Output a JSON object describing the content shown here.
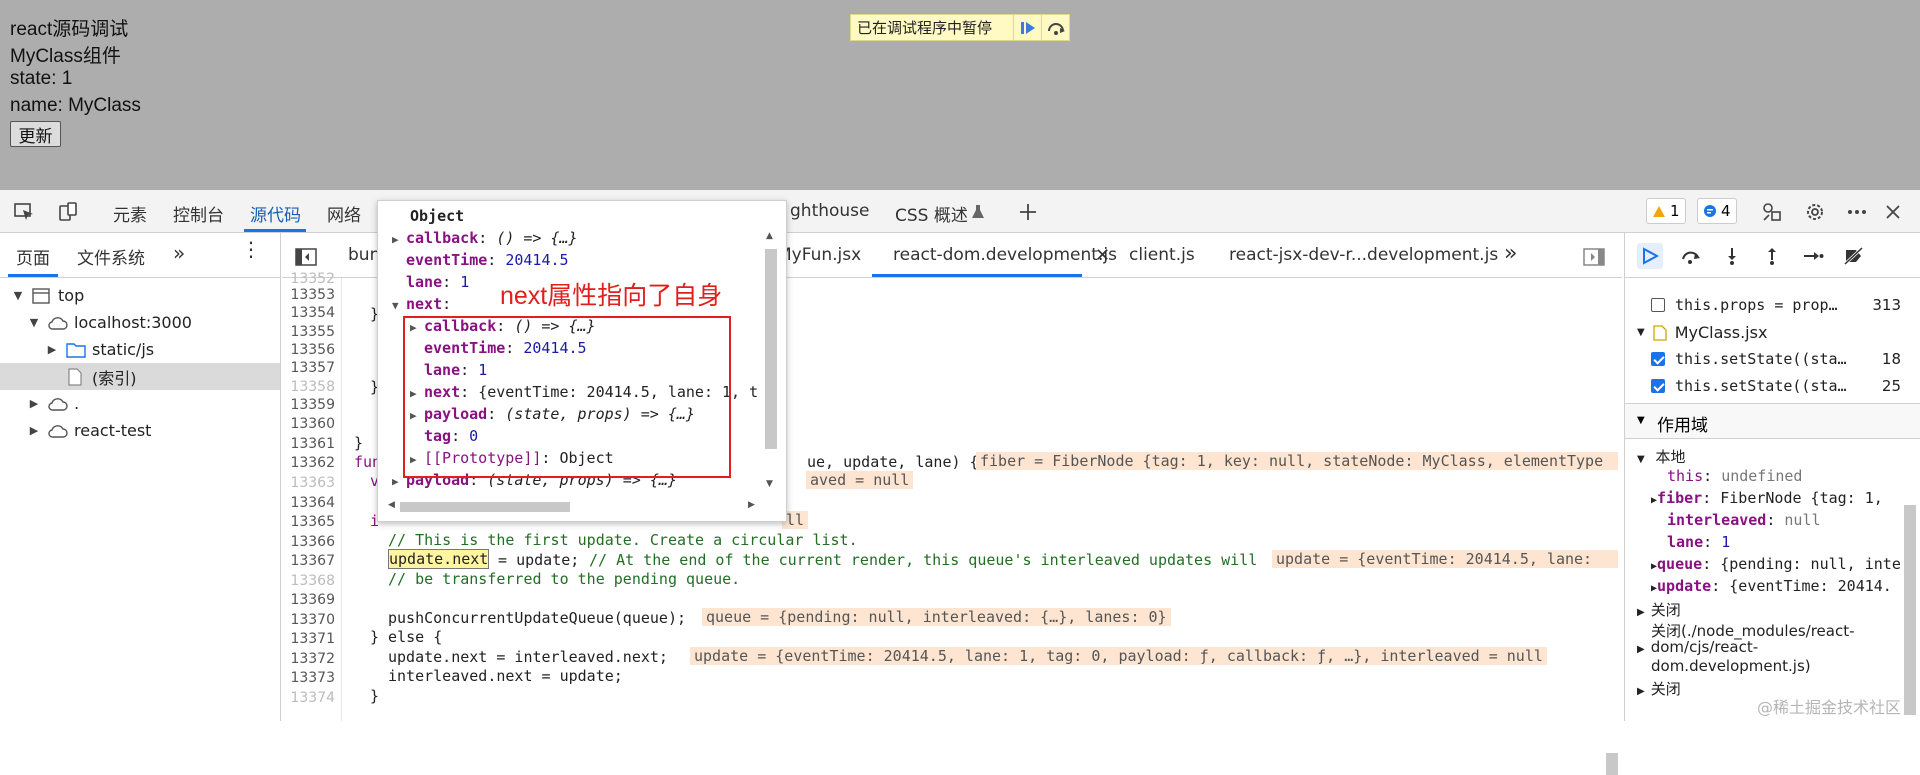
{
  "page": {
    "lines": [
      "react源码调试",
      "MyClass组件",
      "state: 1",
      "name: MyClass"
    ],
    "update_button": "更新",
    "paused_banner": "已在调试程序中暂停"
  },
  "devtools": {
    "tabs": [
      "元素",
      "控制台",
      "源代码",
      "网络",
      "ghthouse",
      "CSS 概述"
    ],
    "active_tab": "源代码",
    "warnings_count": "1",
    "messages_count": "4"
  },
  "navigator": {
    "tabs": [
      "页面",
      "文件系统"
    ],
    "tree": [
      {
        "label": "top"
      },
      {
        "label": "localhost:3000"
      },
      {
        "label": "static/js"
      },
      {
        "label": "(索引)"
      },
      {
        "label": "."
      },
      {
        "label": "react-test"
      }
    ]
  },
  "editor": {
    "tabs": [
      "bun",
      "MyFun.jsx",
      "react-dom.development.js",
      "client.js",
      "react-jsx-dev-r...development.js"
    ],
    "active_tab": "react-dom.development.js",
    "line_numbers": [
      "13352",
      "13353",
      "13354",
      "13355",
      "13356",
      "13357",
      "13358",
      "13359",
      "13360",
      "13361",
      "13362",
      "13363",
      "13364",
      "13365",
      "13366",
      "13367",
      "13368",
      "13369",
      "13370",
      "13371",
      "13372",
      "13373",
      "13374"
    ],
    "code": {
      "l13353": "}",
      "l13357": "}",
      "l13359": "c",
      "l13360": "}",
      "l13361_a": "fun",
      "l13361_b": "ue, update, lane) {",
      "l13362_a": "v",
      "l13364_a": "i",
      "l13365": "// This is the first update. Create a circular list.",
      "l13366_a": "update.next",
      "l13366_b": " = update; ",
      "l13366_c": "// At the end of the current render, this queue's interleaved updates will",
      "l13367": "// be transferred to the pending queue.",
      "l13369": "pushConcurrentUpdateQueue(queue);",
      "l13370": "} else {",
      "l13371": "update.next = interleaved.next;",
      "l13372": "interleaved.next = update;",
      "l13373": "}"
    },
    "inline_values": {
      "fiber": "fiber = FiberNode {tag: 1, key: null, stateNode: MyClass, elementType",
      "interleaved": "aved = null",
      "l13364": "ll",
      "update": "update = {eventTime: 20414.5, lane:",
      "queue": "queue = {pending: null, interleaved: {…}, lanes: 0}",
      "update_full": "update = {eventTime: 20414.5, lane: 1, tag: 0, payload: ƒ, callback: ƒ, …}, interleaved = null"
    }
  },
  "popover": {
    "title": "Object",
    "rows": {
      "callback_k": "callback",
      "callback_v": "() => {…}",
      "eventTime_k": "eventTime",
      "eventTime_v": "20414.5",
      "lane_k": "lane",
      "lane_v": "1",
      "next_k": "next",
      "n_callback_k": "callback",
      "n_callback_v": "() => {…}",
      "n_eventTime_k": "eventTime",
      "n_eventTime_v": "20414.5",
      "n_lane_k": "lane",
      "n_lane_v": "1",
      "n_next_k": "next",
      "n_next_v": "{eventTime: 20414.5, lane: 1, t",
      "n_payload_k": "payload",
      "n_payload_v": "(state, props) => {…}",
      "n_tag_k": "tag",
      "n_tag_v": "0",
      "n_proto_k": "[[Prototype]]",
      "n_proto_v": "Object",
      "payload_k": "payload",
      "payload_v": "(state, props) => {…}"
    }
  },
  "annotation": "next属性指向了自身",
  "debugger": {
    "breakpoints": [
      {
        "file": "",
        "text": "this.props = prop…",
        "line": "313",
        "checked": false
      },
      {
        "file": "MyClass.jsx"
      },
      {
        "text": "this.setState((sta…",
        "line": "18",
        "checked": true
      },
      {
        "text": "this.setState((sta…",
        "line": "25",
        "checked": true
      }
    ],
    "scope_title": "作用域",
    "local_title": "本地",
    "scope": {
      "this_k": "this",
      "this_v": "undefined",
      "fiber_k": "fiber",
      "fiber_v": "FiberNode {tag: 1,",
      "interleaved_k": "interleaved",
      "interleaved_v": "null",
      "lane_k": "lane",
      "lane_v": "1",
      "queue_k": "queue",
      "queue_v": "{pending: null, inte",
      "update_k": "update",
      "update_v": "{eventTime: 20414.",
      "closure1": "关闭",
      "closure2": "关闭(./node_modules/react-",
      "closure2b": "dom/cjs/react-",
      "closure2c": "dom.development.js)",
      "closure3": "关闭"
    }
  },
  "watermark": "@稀土掘金技术社区",
  "colors": {
    "accent": "#1a73e8",
    "annotation": "#e0201c",
    "page_bg": "#adadad"
  }
}
